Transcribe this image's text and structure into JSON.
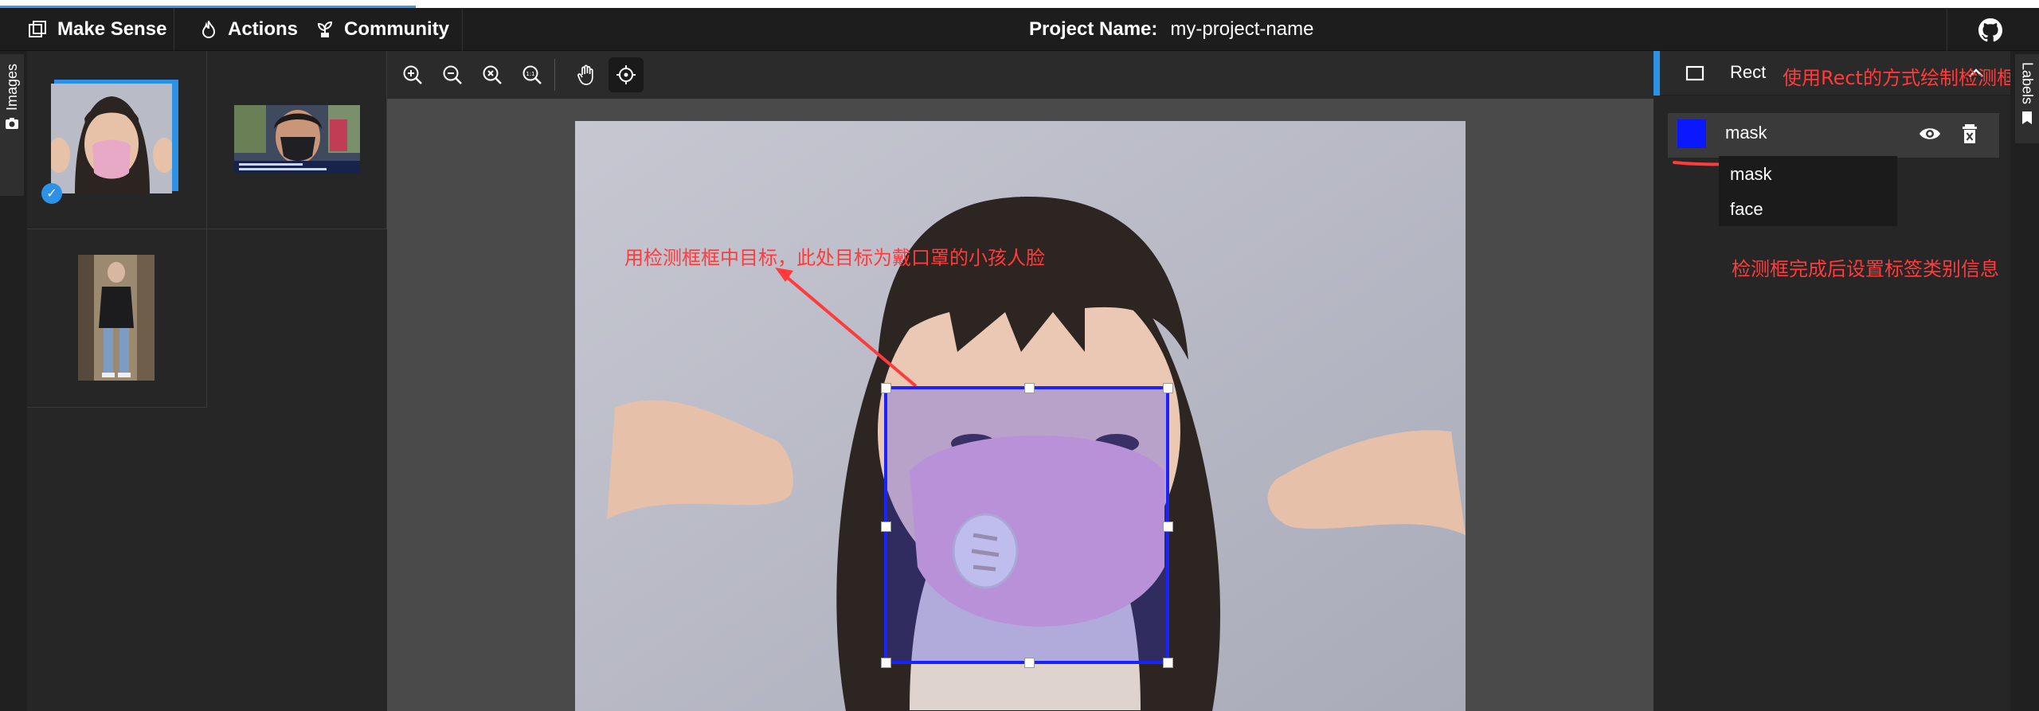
{
  "app": {
    "brand": "Make Sense",
    "nav": [
      {
        "label": "Actions",
        "icon": "flame-icon"
      },
      {
        "label": "Community",
        "icon": "plant-icon"
      }
    ],
    "project_label": "Project Name:",
    "project_value": "my-project-name",
    "github_icon": "github-icon"
  },
  "left_tab": {
    "label": "Images",
    "icon": "camera-icon"
  },
  "right_tab": {
    "label": "Labels",
    "icon": "tag-icon"
  },
  "thumbnails": [
    {
      "name": "girl-mask",
      "selected": true,
      "check_icon": "check-icon"
    },
    {
      "name": "woman-mask",
      "selected": false
    },
    {
      "name": "person-street",
      "selected": false
    }
  ],
  "toolbar": {
    "tools": [
      "zoom-in-icon",
      "zoom-out-icon",
      "zoom-fit-icon",
      "zoom-reset-icon",
      "hand-icon",
      "crosshair-icon"
    ],
    "active": "crosshair-icon"
  },
  "annotations": {
    "bbox_note": "用检测框框中目标，此处目标为戴口罩的小孩人脸",
    "rect_note": "使用Rect的方式绘制检测框",
    "label_note": "检测框完成后设置标签类别信息"
  },
  "right_panel": {
    "title": "Rect",
    "selected_label": "mask",
    "swatch_color": "#0b18ff",
    "options": [
      "mask",
      "face"
    ]
  },
  "colors": {
    "accent": "#2d92e6",
    "bbox": "#1a22ff",
    "annotation": "#ff3b3b"
  },
  "progress": 0.204
}
